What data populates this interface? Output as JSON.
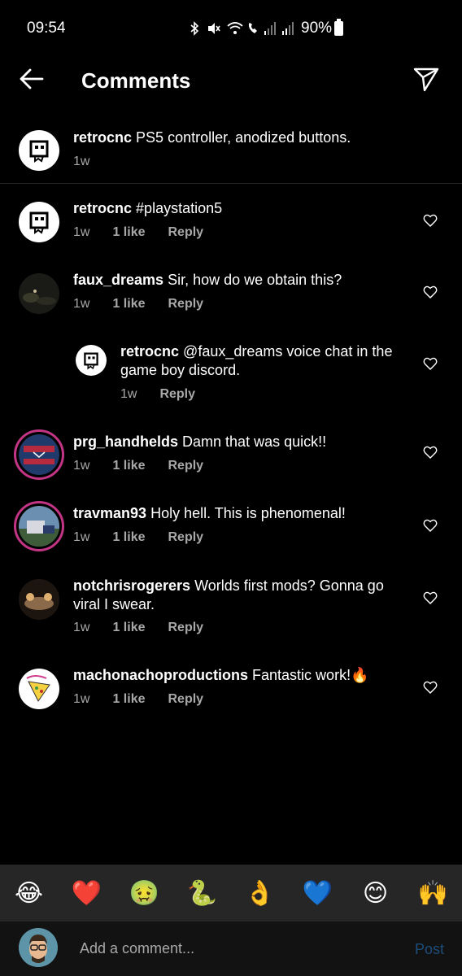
{
  "status_bar": {
    "time": "09:54",
    "battery": "90%"
  },
  "header": {
    "title": "Comments"
  },
  "caption": {
    "username": "retrocnc",
    "text": "PS5 controller, anodized buttons.",
    "time": "1w"
  },
  "comments": [
    {
      "username": "retrocnc",
      "text": "#playstation5",
      "time": "1w",
      "likes": "1 like",
      "reply": "Reply"
    },
    {
      "username": "faux_dreams",
      "text": "Sir, how do we obtain this?",
      "time": "1w",
      "likes": "1 like",
      "reply": "Reply"
    },
    {
      "username": "retrocnc",
      "text_line1": "@faux_dreams voice chat in the",
      "text_line2": "game boy discord.",
      "time": "1w",
      "reply": "Reply"
    },
    {
      "username": "prg_handhelds",
      "text": "Damn that was quick!!",
      "time": "1w",
      "likes": "1 like",
      "reply": "Reply"
    },
    {
      "username": "travman93",
      "text": "Holy hell. This is phenomenal!",
      "time": "1w",
      "likes": "1 like",
      "reply": "Reply"
    },
    {
      "username": "notchrisrogerers",
      "text_line1": "Worlds first mods? Gonna go",
      "text_line2": "viral I swear.",
      "time": "1w",
      "likes": "1 like",
      "reply": "Reply"
    },
    {
      "username": "machonachoproductions",
      "text": "Fantastic work!🔥",
      "time": "1w",
      "likes": "1 like",
      "reply": "Reply"
    }
  ],
  "emojis": [
    "😂",
    "❤️",
    "🤢",
    "🐍",
    "👌",
    "💙",
    "😊",
    "🙌"
  ],
  "comment_bar": {
    "placeholder": "Add a comment...",
    "post_label": "Post"
  },
  "colors": {
    "background": "#000000",
    "meta_text": "#a8a8a8",
    "emoji_bar": "#262626",
    "post_disabled": "#1d4d7a"
  }
}
